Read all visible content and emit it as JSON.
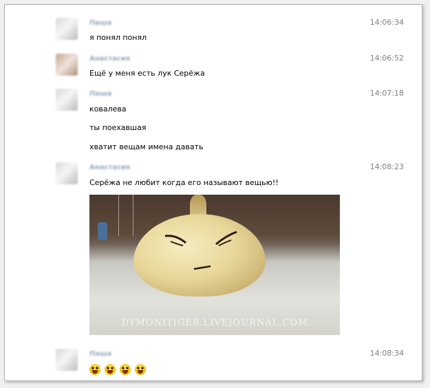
{
  "messages": [
    {
      "sender": "Паша",
      "time": "14:06:34",
      "lines": [
        "я понял понял"
      ]
    },
    {
      "sender": "Анастасия",
      "time": "14:06:52",
      "lines": [
        "Ещё у меня есть лук Серёжа"
      ]
    },
    {
      "sender": "Паша",
      "time": "14:07:18",
      "lines": [
        "ковалева",
        "ты поехавшая",
        "хватит вещам имена давать"
      ]
    },
    {
      "sender": "Анастасия",
      "time": "14:08:23",
      "lines": [
        "Серёжа не любит когда его называют вещью!!"
      ],
      "photo_watermark": "DYMONITIGER.LIVEJOURNAL.COM"
    },
    {
      "sender": "Паша",
      "time": "14:08:34",
      "emoji": [
        "laughing-emoji",
        "laughing-emoji",
        "laughing-emoji",
        "laughing-emoji"
      ]
    }
  ]
}
